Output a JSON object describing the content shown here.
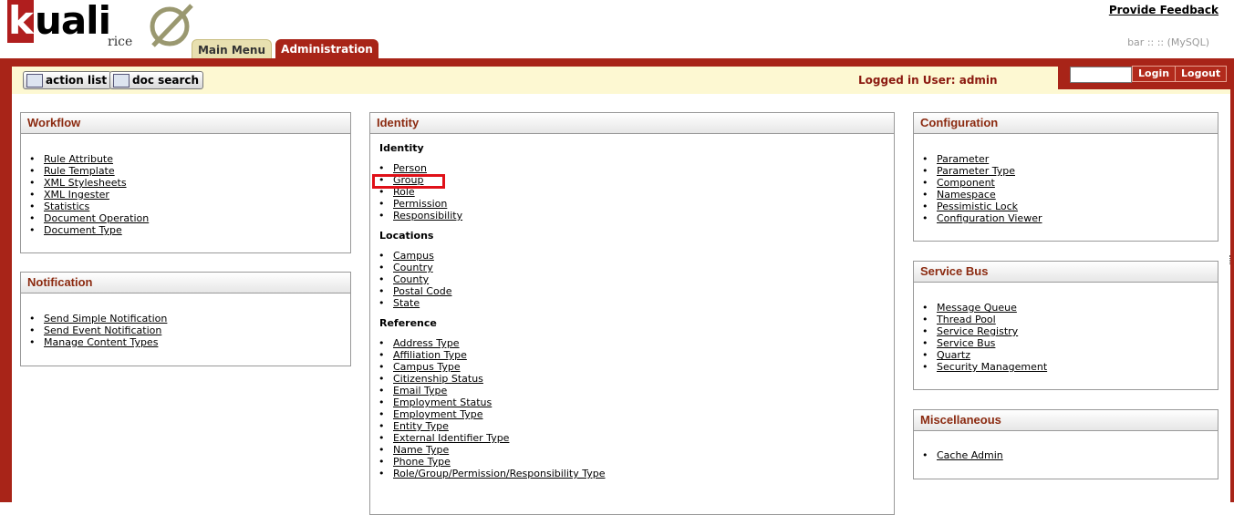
{
  "header": {
    "logo_text": "uali",
    "logo_k": "k",
    "logo_sub": "rice",
    "feedback_link": "Provide Feedback",
    "environment": "bar :: :: (MySQL)",
    "tabs": [
      {
        "label": "Main Menu"
      },
      {
        "label": "Administration"
      }
    ]
  },
  "toolbar": {
    "action_list_label": "action list",
    "doc_search_label": "doc search",
    "logged_in": "Logged in User: admin",
    "login_input_value": "",
    "login_label": "Login",
    "logout_label": "Logout"
  },
  "workflow": {
    "title": "Workflow",
    "links": [
      "Rule Attribute",
      "Rule Template",
      "XML Stylesheets",
      "XML Ingester",
      "Statistics",
      "Document Operation",
      "Document Type"
    ]
  },
  "notification": {
    "title": "Notification",
    "links": [
      "Send Simple Notification",
      "Send Event Notification",
      "Manage Content Types"
    ]
  },
  "identity": {
    "title": "Identity",
    "sections": [
      {
        "heading": "Identity",
        "links": [
          "Person",
          "Group",
          "Role",
          "Permission",
          "Responsibility"
        ]
      },
      {
        "heading": "Locations",
        "links": [
          "Campus",
          "Country",
          "County",
          "Postal Code",
          "State"
        ]
      },
      {
        "heading": "Reference",
        "links": [
          "Address Type",
          "Affiliation Type",
          "Campus Type",
          "Citizenship Status",
          "Email Type",
          "Employment Status",
          "Employment Type",
          "Entity Type",
          "External Identifier Type",
          "Name Type",
          "Phone Type",
          "Role/Group/Permission/Responsibility Type"
        ]
      }
    ]
  },
  "configuration": {
    "title": "Configuration",
    "links": [
      "Parameter",
      "Parameter Type",
      "Component",
      "Namespace",
      "Pessimistic Lock",
      "Configuration Viewer"
    ]
  },
  "service_bus": {
    "title": "Service Bus",
    "links": [
      "Message Queue",
      "Thread Pool",
      "Service Registry",
      "Service Bus",
      "Quartz",
      "Security Management"
    ]
  },
  "miscellaneous": {
    "title": "Miscellaneous",
    "links": [
      "Cache Admin"
    ]
  },
  "colors": {
    "brand_red": "#a82418",
    "toolbar_yellow": "#fdf8d2",
    "heading_text": "#8b2a10",
    "highlight": "#e01018"
  }
}
